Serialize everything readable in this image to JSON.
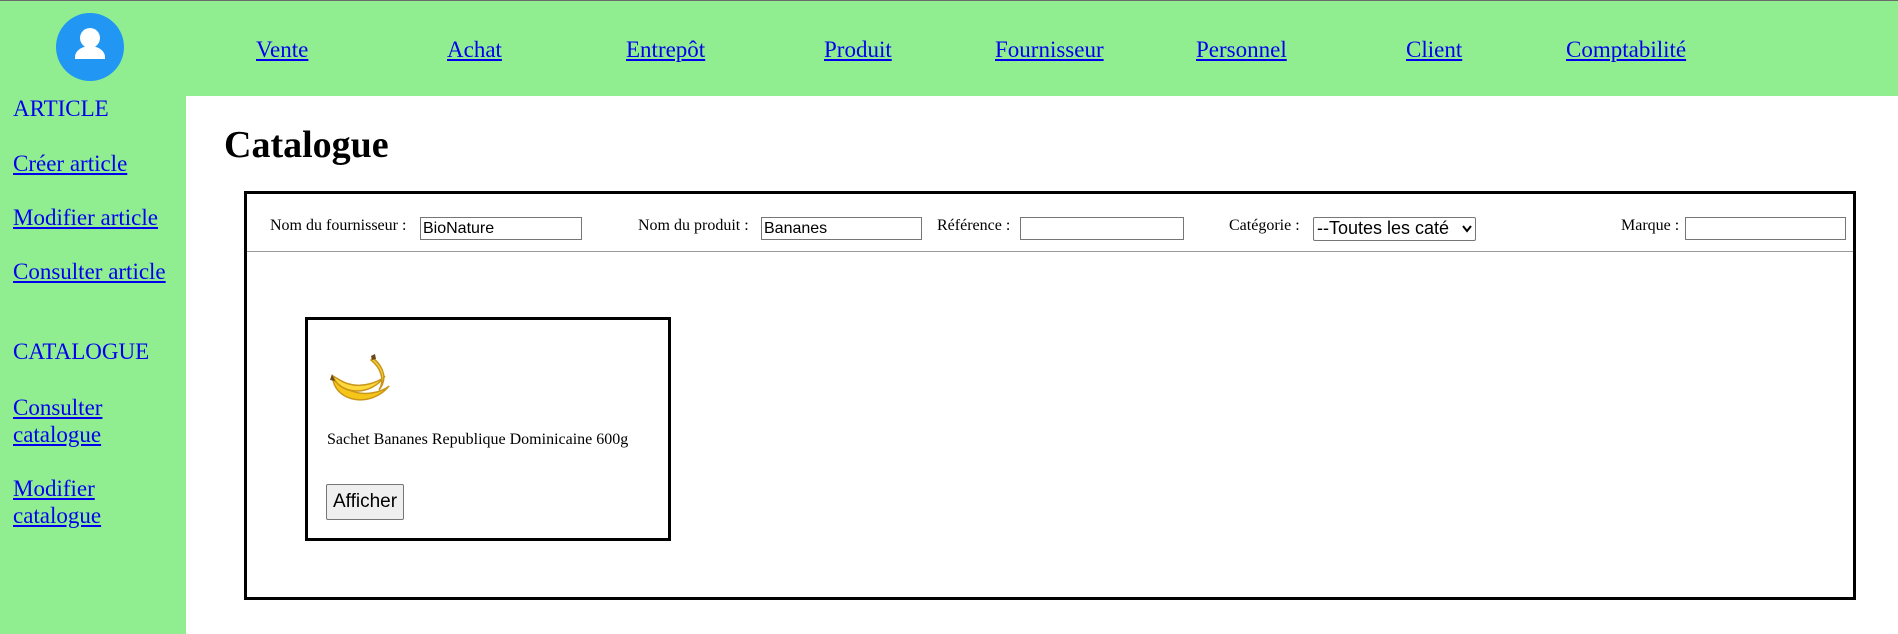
{
  "nav": {
    "items": [
      {
        "label": "Vente"
      },
      {
        "label": "Achat"
      },
      {
        "label": "Entrepôt"
      },
      {
        "label": "Produit"
      },
      {
        "label": "Fournisseur"
      },
      {
        "label": "Personnel"
      },
      {
        "label": "Client"
      },
      {
        "label": "Comptabilité"
      }
    ]
  },
  "sidebar": {
    "article_heading": "ARTICLE",
    "article_items": [
      {
        "label": "Créer article"
      },
      {
        "label": "Modifier article"
      },
      {
        "label": "Consulter article"
      }
    ],
    "catalogue_heading": "CATALOGUE",
    "catalogue_items": [
      {
        "label": "Consulter catalogue"
      },
      {
        "label": "Modifier catalogue"
      }
    ]
  },
  "main": {
    "title": "Catalogue",
    "filters": {
      "supplier_label": "Nom du fournisseur :",
      "supplier_value": "BioNature",
      "product_label": "Nom du produit :",
      "product_value": "Bananes",
      "reference_label": "Référence :",
      "reference_value": "",
      "category_label": "Catégorie :",
      "category_value": "--Toutes les caté",
      "brand_label": "Marque :",
      "brand_value": ""
    },
    "products": [
      {
        "name": "Sachet Bananes Republique Dominicaine 600g",
        "image_icon": "banana-icon",
        "button_label": "Afficher"
      }
    ]
  },
  "colors": {
    "sidebar_bg": "#90ee90",
    "avatar_bg": "#2196f3",
    "link": "#0000ee"
  }
}
